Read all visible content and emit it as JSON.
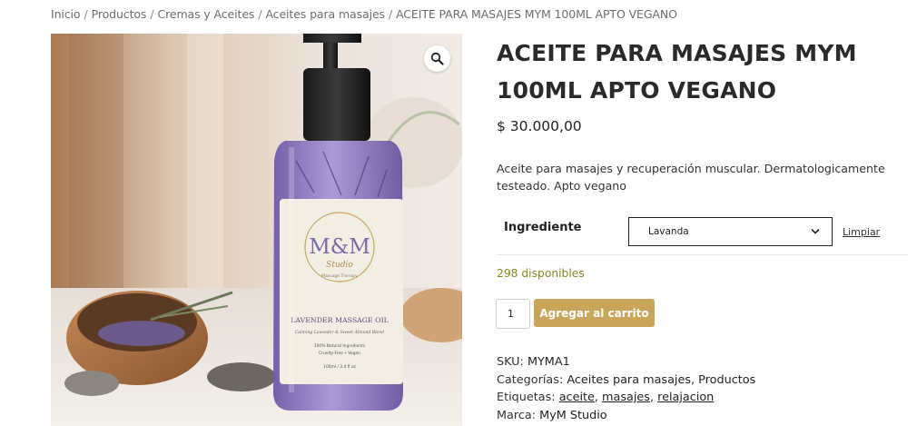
{
  "breadcrumb": {
    "items": [
      "Inicio",
      "Productos",
      "Cremas y Aceites",
      "Aceites para masajes"
    ],
    "current": "ACEITE PARA MASAJES MYM 100ML APTO VEGANO",
    "separator": "/"
  },
  "product": {
    "title_line1": "ACEITE PARA MASAJES MYM",
    "title_line2": "100ML APTO VEGANO",
    "price": "$ 30.000,00",
    "description_line1": "Aceite para masajes y recuperación muscular. Dermatologicamente",
    "description_line2": "testeado. Apto vegano",
    "image": {
      "brand_main": "M&M",
      "brand_script": "Studio",
      "brand_sub": "Massage Therapy",
      "label_title": "LAVENDER MASSAGE OIL",
      "label_tagline": "Calming Lavender & Sweet Almond Blend",
      "label_line1": "100% Natural Ingredients",
      "label_line2": "Cruelty-Free • Vegan",
      "label_volume": "100ml / 3.4 fl oz"
    }
  },
  "variation": {
    "label": "Ingrediente",
    "selected": "Lavanda",
    "clear_label": "Limpiar"
  },
  "stock": "298 disponibles",
  "cart": {
    "quantity": "1",
    "button_label": "Agregar al carrito"
  },
  "meta": {
    "sku_label": "SKU:",
    "sku": "MYMA1",
    "categories_label": "Categorías:",
    "categories": [
      "Aceites para masajes",
      "Productos"
    ],
    "tags_label": "Etiquetas:",
    "tags": [
      "aceite",
      "masajes",
      "relajacion"
    ],
    "brand_label": "Marca:",
    "brand": "MyM Studio"
  },
  "colors": {
    "accent": "#c9a55c",
    "stock": "#8a8423",
    "lavender": "#8e78c0"
  },
  "icons": {
    "zoom": "magnifier-icon",
    "select": "chevron-down-icon"
  }
}
